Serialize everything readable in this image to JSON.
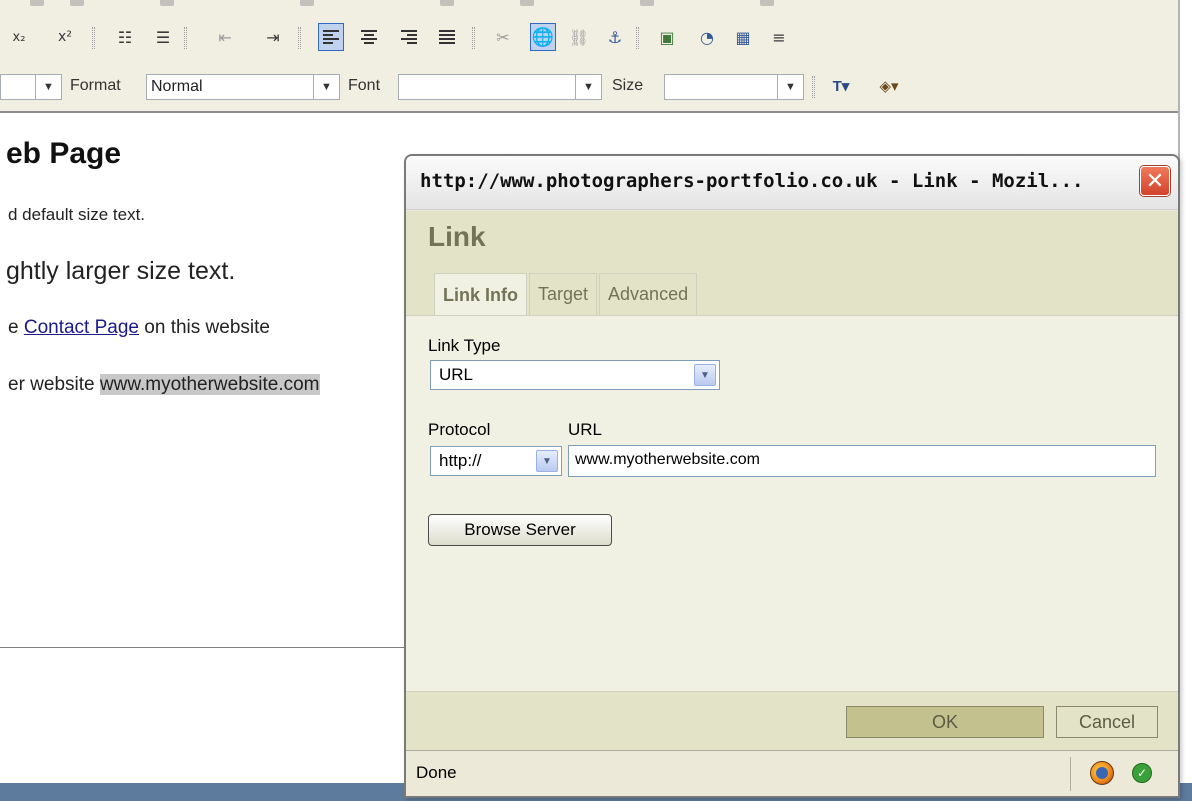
{
  "toolbar": {
    "format_label": "Format",
    "format_value": "Normal",
    "font_label": "Font",
    "font_value": "",
    "size_label": "Size",
    "size_value": ""
  },
  "document": {
    "heading": "eb Page",
    "line1": "d default size text.",
    "line2": "ghtly larger size text.",
    "line3_before": "e ",
    "line3_link": "Contact Page",
    "line3_after": " on this website",
    "line4_before": "er website ",
    "line4_selected": "www.myotherwebsite.com"
  },
  "dialog": {
    "window_title": "http://www.photographers-portfolio.co.uk - Link - Mozil...",
    "heading": "Link",
    "tabs": [
      {
        "label": "Link Info",
        "active": true
      },
      {
        "label": "Target",
        "active": false
      },
      {
        "label": "Advanced",
        "active": false
      }
    ],
    "link_type_label": "Link Type",
    "link_type_value": "URL",
    "protocol_label": "Protocol",
    "protocol_value": "http://",
    "url_label": "URL",
    "url_value": "www.myotherwebsite.com",
    "browse_button": "Browse Server",
    "ok_button": "OK",
    "cancel_button": "Cancel",
    "status_text": "Done"
  },
  "colors": {
    "toolbar_bg": "#f1efe2",
    "dialog_header_bg": "#e3e3c7",
    "dialog_body_bg": "#f1f1e3",
    "ok_button_bg": "#c3c18e",
    "close_button": "#d2432a"
  }
}
